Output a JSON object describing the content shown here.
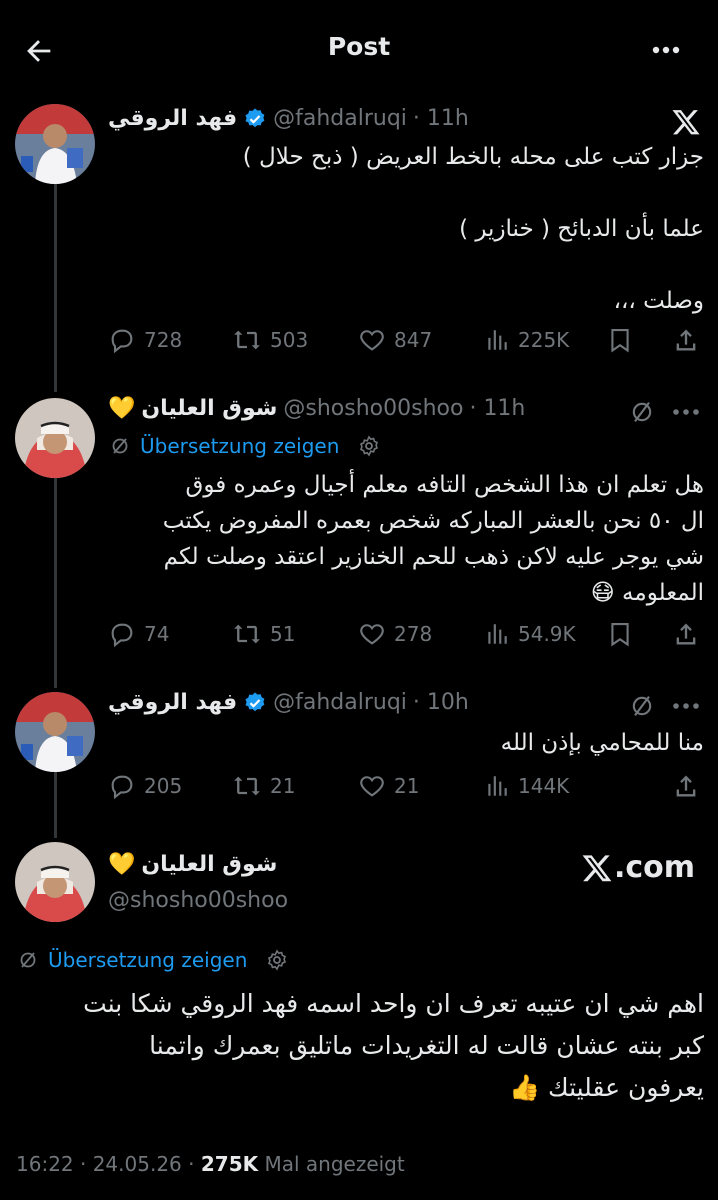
{
  "header": {
    "title": "Post"
  },
  "posts": [
    {
      "name": "فهد الروقي",
      "handle": "@fahdalruqi",
      "time": "· 11h",
      "lines": [
        "جزار كتب على محله بالخط العريض ( ذبح حلال )",
        "علما بأن الدبائح ( خنازير )",
        "وصلت ،،،"
      ],
      "metrics": {
        "replies": "728",
        "reposts": "503",
        "likes": "847",
        "views": "225K"
      }
    },
    {
      "name": "شوق العليان",
      "handle": "@shosho00shoo",
      "time": "· 11h",
      "translate": "Übersetzung zeigen",
      "lines": [
        "هل تعلم ان هذا الشخص التافه معلم أجيال وعمره فوق",
        "ال ٥٠ نحن بالعشر المباركه شخص بعمره المفروض يكتب",
        "شي يوجر عليه لاكن ذهب للحم الخنازير اعتقد وصلت لكم",
        "المعلومه 😷"
      ],
      "metrics": {
        "replies": "74",
        "reposts": "51",
        "likes": "278",
        "views": "54.9K"
      }
    },
    {
      "name": "فهد الروقي",
      "handle": "@fahdalruqi",
      "time": "· 10h",
      "lines": [
        "منا للمحامي بإذن الله"
      ],
      "metrics": {
        "replies": "205",
        "reposts": "21",
        "likes": "21",
        "views": "144K"
      }
    }
  ],
  "main": {
    "name": "شوق العليان",
    "handle": "@shosho00shoo",
    "brand": ".com",
    "translate": "Übersetzung zeigen",
    "lines": [
      "اهم شي ان عتيبه تعرف ان واحد اسمه فهد الروقي شكا بنت",
      "كبر بنته عشان قالت له التغريدات ماتليق بعمرك واتمنا",
      "يعرفون عقليتك 👍"
    ],
    "time": "16:22 · 24.05.26 ·",
    "views": "275K",
    "views_label": "Mal angezeigt"
  },
  "colors": {
    "accent": "#1d9bf0",
    "muted": "#71767b",
    "text": "#e7e9ea",
    "verified": "#1d9bf0",
    "heart": "#f7c948"
  }
}
